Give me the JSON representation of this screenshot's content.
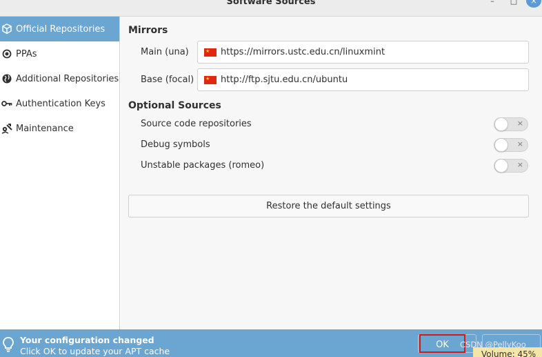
{
  "window": {
    "title": "Software Sources",
    "minimize_glyph": "–",
    "maximize_glyph": "□",
    "close_glyph": "×"
  },
  "sidebar": {
    "items": [
      {
        "label": "Official Repositories",
        "icon": "package-icon",
        "active": true
      },
      {
        "label": "PPAs",
        "icon": "radio-target-icon",
        "active": false
      },
      {
        "label": "Additional Repositories",
        "icon": "globe-icon",
        "active": false
      },
      {
        "label": "Authentication Keys",
        "icon": "key-icon",
        "active": false
      },
      {
        "label": "Maintenance",
        "icon": "tools-icon",
        "active": false
      }
    ]
  },
  "mirrors": {
    "title": "Mirrors",
    "main_label": "Main (una)",
    "main_url": "https://mirrors.ustc.edu.cn/linuxmint",
    "base_label": "Base (focal)",
    "base_url": "http://ftp.sjtu.edu.cn/ubuntu",
    "flag_icon": "china-flag-icon"
  },
  "optional": {
    "title": "Optional Sources",
    "items": [
      {
        "label": "Source code repositories",
        "enabled": false
      },
      {
        "label": "Debug symbols",
        "enabled": false
      },
      {
        "label": "Unstable packages (romeo)",
        "enabled": false
      }
    ],
    "toggle_off_glyph": "×"
  },
  "restore_button": "Restore the default settings",
  "infobar": {
    "line1": "Your configuration changed",
    "line2": "Click OK to update your APT cache",
    "ok_label": "OK",
    "watermark": "CSDN @PellyKoo"
  },
  "osd": {
    "text": "Volume: 45%"
  },
  "colors": {
    "accent": "#6ba5d1",
    "highlight_border": "#d11a1a",
    "osd_background": "#f5e6a8"
  }
}
